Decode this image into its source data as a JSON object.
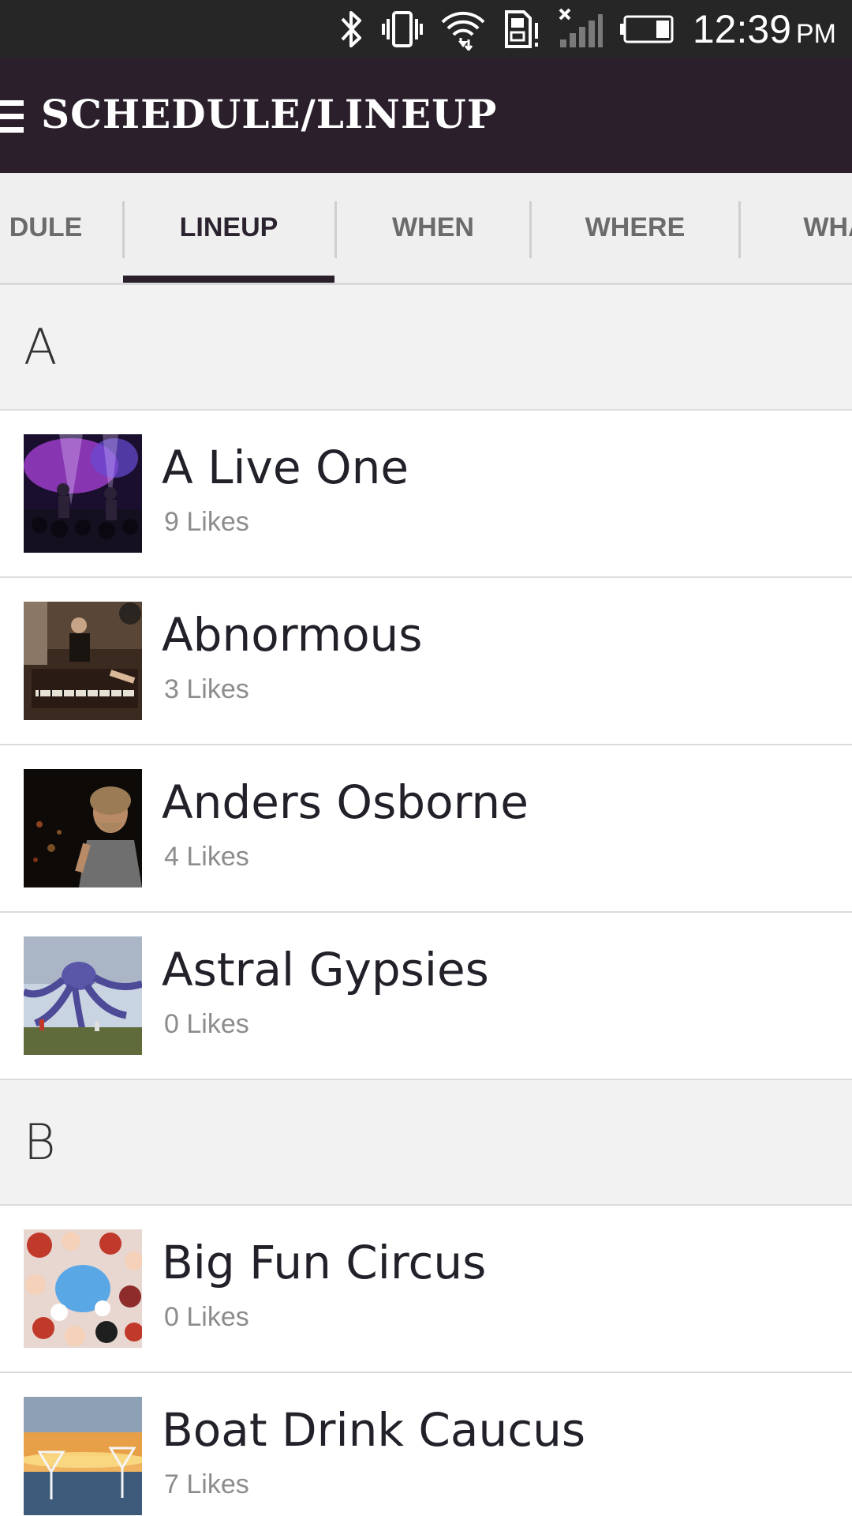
{
  "status_bar": {
    "time": "12:39",
    "ampm": "PM",
    "icons": [
      "bluetooth-icon",
      "vibrate-icon",
      "wifi-icon",
      "sd-card-alert-icon",
      "signal-no-service-icon",
      "battery-icon"
    ]
  },
  "app_bar": {
    "title": "SCHEDULE/LINEUP",
    "menu_icon": "hamburger-menu-icon"
  },
  "tabs": [
    {
      "label": "DULE",
      "active": false
    },
    {
      "label": "LINEUP",
      "active": true
    },
    {
      "label": "WHEN",
      "active": false
    },
    {
      "label": "WHERE",
      "active": false
    },
    {
      "label": "WHA",
      "active": false
    }
  ],
  "sections": [
    {
      "letter": "A",
      "items": [
        {
          "name": "A Live One",
          "likes": "9 Likes"
        },
        {
          "name": "Abnormous",
          "likes": "3 Likes"
        },
        {
          "name": "Anders Osborne",
          "likes": "4 Likes"
        },
        {
          "name": "Astral Gypsies",
          "likes": "0 Likes"
        }
      ]
    },
    {
      "letter": "B",
      "items": [
        {
          "name": "Big Fun Circus",
          "likes": "0 Likes"
        },
        {
          "name": "Boat Drink Caucus",
          "likes": "7 Likes"
        }
      ]
    }
  ],
  "colors": {
    "status_bar_bg": "#262626",
    "app_bar_bg": "#2a1f2b",
    "tab_bg": "#efefef",
    "tab_indicator": "#2a1f2b",
    "section_bg": "#f2f2f2"
  }
}
